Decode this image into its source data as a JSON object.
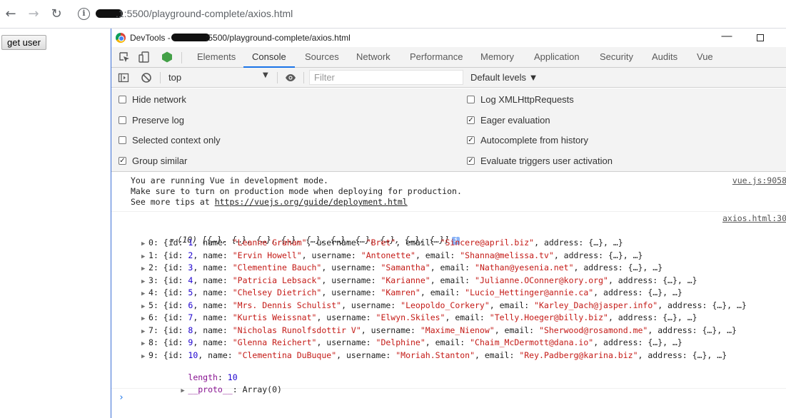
{
  "browser": {
    "url_text": ".1:5500/playground-complete/axios.html",
    "back_icon": "arrow-left-icon",
    "forward_icon": "arrow-right-icon",
    "reload_icon": "reload-icon",
    "info_icon": "info-icon"
  },
  "page": {
    "button_label": "get user"
  },
  "devtools": {
    "title_prefix": "DevTools - ",
    "title_url": ":5500/playground-complete/axios.html",
    "tabs": [
      "Elements",
      "Console",
      "Sources",
      "Network",
      "Performance",
      "Memory",
      "Application",
      "Security",
      "Audits",
      "Vue"
    ],
    "active_tab": "Console",
    "toolbar": {
      "context": "top",
      "filter_placeholder": "Filter",
      "levels": "Default levels ▼"
    },
    "settings": [
      {
        "label": "Hide network",
        "checked": false
      },
      {
        "label": "Preserve log",
        "checked": false
      },
      {
        "label": "Selected context only",
        "checked": false
      },
      {
        "label": "Group similar",
        "checked": true
      },
      {
        "label": "Log XMLHttpRequests",
        "checked": false
      },
      {
        "label": "Eager evaluation",
        "checked": true
      },
      {
        "label": "Autocomplete from history",
        "checked": true
      },
      {
        "label": "Evaluate triggers user activation",
        "checked": true
      }
    ],
    "vue_message": {
      "line1": "You are running Vue in development mode.",
      "line2": "Make sure to turn on production mode when deploying for production.",
      "line3_prefix": "See more tips at ",
      "line3_link": "https://vuejs.org/guide/deployment.html",
      "source": "vue.js:9058"
    },
    "axios_message": {
      "source": "axios.html:30",
      "summary": "(10) [{…}, {…}, {…}, {…}, {…}, {…}, {…}, {…}, {…}, {…}]",
      "items": [
        {
          "id": "1",
          "name": "\"Leanne Graham\"",
          "username": "\"Bret\"",
          "email": "\"Sincere@april.biz\""
        },
        {
          "id": "2",
          "name": "\"Ervin Howell\"",
          "username": "\"Antonette\"",
          "email": "\"Shanna@melissa.tv\""
        },
        {
          "id": "3",
          "name": "\"Clementine Bauch\"",
          "username": "\"Samantha\"",
          "email": "\"Nathan@yesenia.net\""
        },
        {
          "id": "4",
          "name": "\"Patricia Lebsack\"",
          "username": "\"Karianne\"",
          "email": "\"Julianne.OConner@kory.org\""
        },
        {
          "id": "5",
          "name": "\"Chelsey Dietrich\"",
          "username": "\"Kamren\"",
          "email": "\"Lucio_Hettinger@annie.ca\""
        },
        {
          "id": "6",
          "name": "\"Mrs. Dennis Schulist\"",
          "username": "\"Leopoldo_Corkery\"",
          "email": "\"Karley_Dach@jasper.info\""
        },
        {
          "id": "7",
          "name": "\"Kurtis Weissnat\"",
          "username": "\"Elwyn.Skiles\"",
          "email": "\"Telly.Hoeger@billy.biz\""
        },
        {
          "id": "8",
          "name": "\"Nicholas Runolfsdottir V\"",
          "username": "\"Maxime_Nienow\"",
          "email": "\"Sherwood@rosamond.me\""
        },
        {
          "id": "9",
          "name": "\"Glenna Reichert\"",
          "username": "\"Delphine\"",
          "email": "\"Chaim_McDermott@dana.io\""
        },
        {
          "id": "10",
          "name": "\"Clementina DuBuque\"",
          "username": "\"Moriah.Stanton\"",
          "email": "\"Rey.Padberg@karina.biz\""
        }
      ],
      "length_label": "length",
      "length_value": "10",
      "proto_label": "__proto__",
      "proto_value": "Array(0)"
    },
    "prompt_symbol": "›"
  }
}
